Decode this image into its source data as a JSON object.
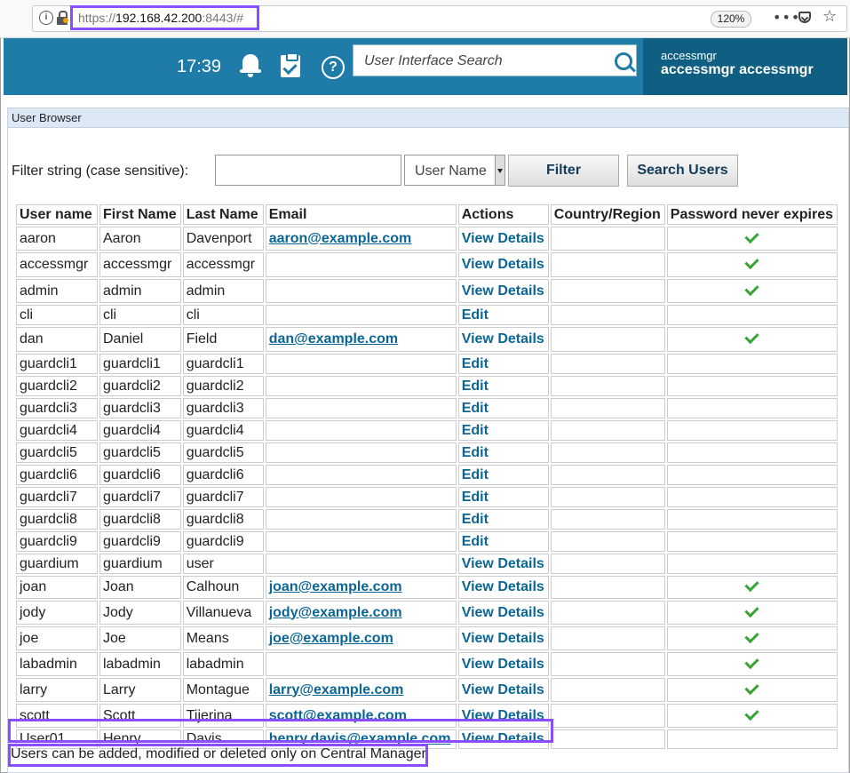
{
  "browser": {
    "url_scheme": "https://",
    "url_host": "192.168.42.200",
    "url_rest": ":8443/#",
    "zoom": "120%",
    "more_icon": "dots-menu-icon",
    "pocket_icon": "pocket-icon",
    "star_icon": "bookmark-star-icon"
  },
  "header": {
    "time": "17:39",
    "search_placeholder": "User Interface Search",
    "user_short": "accessmgr",
    "user_full": "accessmgr accessmgr",
    "bg_color": "#1f7ba8",
    "user_bg_color": "#0e5f82"
  },
  "panel": {
    "title": "User Browser",
    "filter_label": "Filter string (case sensitive):",
    "filter_value": "",
    "select_value": "User Name",
    "filter_button": "Filter",
    "search_button": "Search Users"
  },
  "table": {
    "columns": [
      "User name",
      "First Name",
      "Last Name",
      "Email",
      "Actions",
      "Country/Region",
      "Password never expires"
    ],
    "rows": [
      {
        "username": "aaron",
        "first": "Aaron",
        "last": "Davenport",
        "email": "aaron@example.com",
        "action": "View Details",
        "country": "",
        "pw": true
      },
      {
        "username": "accessmgr",
        "first": "accessmgr",
        "last": "accessmgr",
        "email": "",
        "action": "View Details",
        "country": "",
        "pw": true
      },
      {
        "username": "admin",
        "first": "admin",
        "last": "admin",
        "email": "",
        "action": "View Details",
        "country": "",
        "pw": true
      },
      {
        "username": "cli",
        "first": "cli",
        "last": "cli",
        "email": "",
        "action": "Edit",
        "country": "",
        "pw": false
      },
      {
        "username": "dan",
        "first": "Daniel",
        "last": "Field",
        "email": "dan@example.com",
        "action": "View Details",
        "country": "",
        "pw": true
      },
      {
        "username": "guardcli1",
        "first": "guardcli1",
        "last": "guardcli1",
        "email": "",
        "action": "Edit",
        "country": "",
        "pw": false
      },
      {
        "username": "guardcli2",
        "first": "guardcli2",
        "last": "guardcli2",
        "email": "",
        "action": "Edit",
        "country": "",
        "pw": false
      },
      {
        "username": "guardcli3",
        "first": "guardcli3",
        "last": "guardcli3",
        "email": "",
        "action": "Edit",
        "country": "",
        "pw": false
      },
      {
        "username": "guardcli4",
        "first": "guardcli4",
        "last": "guardcli4",
        "email": "",
        "action": "Edit",
        "country": "",
        "pw": false
      },
      {
        "username": "guardcli5",
        "first": "guardcli5",
        "last": "guardcli5",
        "email": "",
        "action": "Edit",
        "country": "",
        "pw": false
      },
      {
        "username": "guardcli6",
        "first": "guardcli6",
        "last": "guardcli6",
        "email": "",
        "action": "Edit",
        "country": "",
        "pw": false
      },
      {
        "username": "guardcli7",
        "first": "guardcli7",
        "last": "guardcli7",
        "email": "",
        "action": "Edit",
        "country": "",
        "pw": false
      },
      {
        "username": "guardcli8",
        "first": "guardcli8",
        "last": "guardcli8",
        "email": "",
        "action": "Edit",
        "country": "",
        "pw": false
      },
      {
        "username": "guardcli9",
        "first": "guardcli9",
        "last": "guardcli9",
        "email": "",
        "action": "Edit",
        "country": "",
        "pw": false
      },
      {
        "username": "guardium",
        "first": "guardium",
        "last": "user",
        "email": "",
        "action": "View Details",
        "country": "",
        "pw": false
      },
      {
        "username": "joan",
        "first": "Joan",
        "last": "Calhoun",
        "email": "joan@example.com",
        "action": "View Details",
        "country": "",
        "pw": true
      },
      {
        "username": "jody",
        "first": "Jody",
        "last": "Villanueva",
        "email": "jody@example.com",
        "action": "View Details",
        "country": "",
        "pw": true
      },
      {
        "username": "joe",
        "first": "Joe",
        "last": "Means",
        "email": "joe@example.com",
        "action": "View Details",
        "country": "",
        "pw": true
      },
      {
        "username": "labadmin",
        "first": "labadmin",
        "last": "labadmin",
        "email": "",
        "action": "View Details",
        "country": "",
        "pw": true
      },
      {
        "username": "larry",
        "first": "Larry",
        "last": "Montague",
        "email": "larry@example.com",
        "action": "View Details",
        "country": "",
        "pw": true
      },
      {
        "username": "scott",
        "first": "Scott",
        "last": "Tijerina",
        "email": "scott@example.com",
        "action": "View Details",
        "country": "",
        "pw": true
      },
      {
        "username": "User01",
        "first": "Henry",
        "last": "Davis",
        "email": "henry.davis@example.com",
        "action": "View Details",
        "country": "",
        "pw": false
      }
    ],
    "check_color": "#3aa335",
    "link_color": "#0c6695"
  },
  "footer_note": "Users can be added, modified or deleted only on Central Manager",
  "highlight_color": "#8a4dff"
}
